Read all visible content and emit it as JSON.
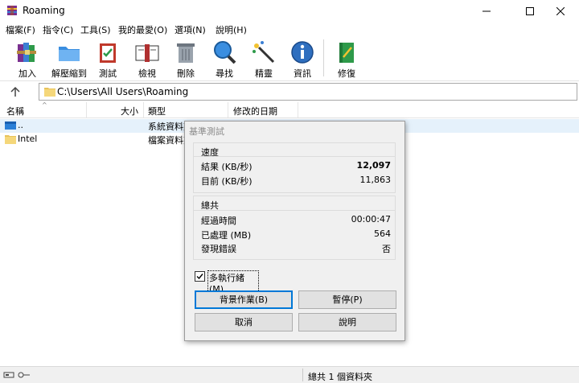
{
  "window": {
    "title": "Roaming"
  },
  "menu": [
    "檔案(F)",
    "指令(C)",
    "工具(S)",
    "我的最愛(O)",
    "選項(N)",
    "說明(H)"
  ],
  "toolbar": {
    "buttons": [
      "加入",
      "解壓縮到",
      "測試",
      "檢視",
      "刪除",
      "尋找",
      "精靈",
      "資訊",
      "修復"
    ]
  },
  "address": {
    "path": "C:\\Users\\All Users\\Roaming",
    "up_icon": "arrow-up-icon"
  },
  "columns": {
    "name": "名稱",
    "size": "大小",
    "type": "類型",
    "modified": "修改的日期"
  },
  "files": [
    {
      "name": "..",
      "type": "系統資料夾"
    },
    {
      "name": "Intel",
      "type": "檔案資料夾"
    }
  ],
  "status": {
    "text": "總共 1 個資料夾"
  },
  "dialog": {
    "title": "基準測試",
    "speed": {
      "heading": "速度",
      "result_label": "結果 (KB/秒)",
      "result_value": "12,097",
      "current_label": "目前 (KB/秒)",
      "current_value": "11,863"
    },
    "total": {
      "heading": "總共",
      "elapsed_label": "經過時間",
      "elapsed_value": "00:00:47",
      "processed_label": "已處理 (MB)",
      "processed_value": "564",
      "errors_label": "發現錯誤",
      "errors_value": "否"
    },
    "multithread_label": "多執行緒(M)",
    "multithread_checked": true,
    "buttons": {
      "background": "背景作業(B)",
      "pause": "暫停(P)",
      "cancel": "取消",
      "help": "說明"
    }
  },
  "colors": {
    "accent": "#0078d7",
    "selection": "#e5f1fb"
  }
}
